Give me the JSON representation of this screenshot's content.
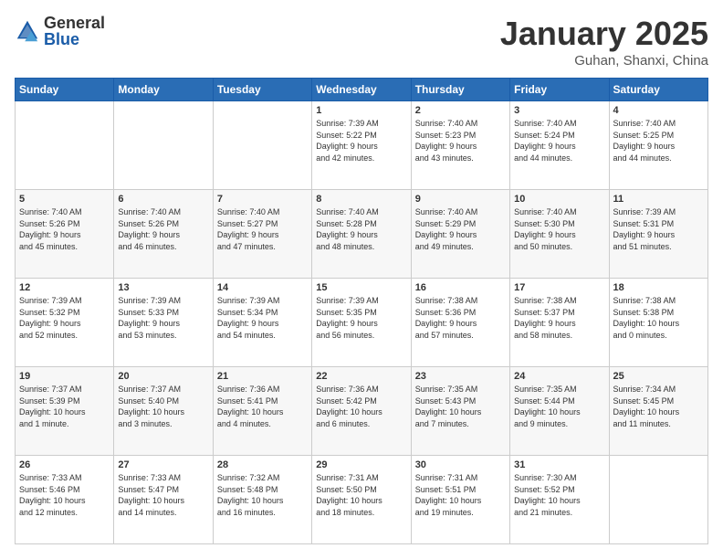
{
  "header": {
    "logo_general": "General",
    "logo_blue": "Blue",
    "title": "January 2025",
    "location": "Guhan, Shanxi, China"
  },
  "weekdays": [
    "Sunday",
    "Monday",
    "Tuesday",
    "Wednesday",
    "Thursday",
    "Friday",
    "Saturday"
  ],
  "weeks": [
    [
      {
        "day": "",
        "info": ""
      },
      {
        "day": "",
        "info": ""
      },
      {
        "day": "",
        "info": ""
      },
      {
        "day": "1",
        "info": "Sunrise: 7:39 AM\nSunset: 5:22 PM\nDaylight: 9 hours\nand 42 minutes."
      },
      {
        "day": "2",
        "info": "Sunrise: 7:40 AM\nSunset: 5:23 PM\nDaylight: 9 hours\nand 43 minutes."
      },
      {
        "day": "3",
        "info": "Sunrise: 7:40 AM\nSunset: 5:24 PM\nDaylight: 9 hours\nand 44 minutes."
      },
      {
        "day": "4",
        "info": "Sunrise: 7:40 AM\nSunset: 5:25 PM\nDaylight: 9 hours\nand 44 minutes."
      }
    ],
    [
      {
        "day": "5",
        "info": "Sunrise: 7:40 AM\nSunset: 5:26 PM\nDaylight: 9 hours\nand 45 minutes."
      },
      {
        "day": "6",
        "info": "Sunrise: 7:40 AM\nSunset: 5:26 PM\nDaylight: 9 hours\nand 46 minutes."
      },
      {
        "day": "7",
        "info": "Sunrise: 7:40 AM\nSunset: 5:27 PM\nDaylight: 9 hours\nand 47 minutes."
      },
      {
        "day": "8",
        "info": "Sunrise: 7:40 AM\nSunset: 5:28 PM\nDaylight: 9 hours\nand 48 minutes."
      },
      {
        "day": "9",
        "info": "Sunrise: 7:40 AM\nSunset: 5:29 PM\nDaylight: 9 hours\nand 49 minutes."
      },
      {
        "day": "10",
        "info": "Sunrise: 7:40 AM\nSunset: 5:30 PM\nDaylight: 9 hours\nand 50 minutes."
      },
      {
        "day": "11",
        "info": "Sunrise: 7:39 AM\nSunset: 5:31 PM\nDaylight: 9 hours\nand 51 minutes."
      }
    ],
    [
      {
        "day": "12",
        "info": "Sunrise: 7:39 AM\nSunset: 5:32 PM\nDaylight: 9 hours\nand 52 minutes."
      },
      {
        "day": "13",
        "info": "Sunrise: 7:39 AM\nSunset: 5:33 PM\nDaylight: 9 hours\nand 53 minutes."
      },
      {
        "day": "14",
        "info": "Sunrise: 7:39 AM\nSunset: 5:34 PM\nDaylight: 9 hours\nand 54 minutes."
      },
      {
        "day": "15",
        "info": "Sunrise: 7:39 AM\nSunset: 5:35 PM\nDaylight: 9 hours\nand 56 minutes."
      },
      {
        "day": "16",
        "info": "Sunrise: 7:38 AM\nSunset: 5:36 PM\nDaylight: 9 hours\nand 57 minutes."
      },
      {
        "day": "17",
        "info": "Sunrise: 7:38 AM\nSunset: 5:37 PM\nDaylight: 9 hours\nand 58 minutes."
      },
      {
        "day": "18",
        "info": "Sunrise: 7:38 AM\nSunset: 5:38 PM\nDaylight: 10 hours\nand 0 minutes."
      }
    ],
    [
      {
        "day": "19",
        "info": "Sunrise: 7:37 AM\nSunset: 5:39 PM\nDaylight: 10 hours\nand 1 minute."
      },
      {
        "day": "20",
        "info": "Sunrise: 7:37 AM\nSunset: 5:40 PM\nDaylight: 10 hours\nand 3 minutes."
      },
      {
        "day": "21",
        "info": "Sunrise: 7:36 AM\nSunset: 5:41 PM\nDaylight: 10 hours\nand 4 minutes."
      },
      {
        "day": "22",
        "info": "Sunrise: 7:36 AM\nSunset: 5:42 PM\nDaylight: 10 hours\nand 6 minutes."
      },
      {
        "day": "23",
        "info": "Sunrise: 7:35 AM\nSunset: 5:43 PM\nDaylight: 10 hours\nand 7 minutes."
      },
      {
        "day": "24",
        "info": "Sunrise: 7:35 AM\nSunset: 5:44 PM\nDaylight: 10 hours\nand 9 minutes."
      },
      {
        "day": "25",
        "info": "Sunrise: 7:34 AM\nSunset: 5:45 PM\nDaylight: 10 hours\nand 11 minutes."
      }
    ],
    [
      {
        "day": "26",
        "info": "Sunrise: 7:33 AM\nSunset: 5:46 PM\nDaylight: 10 hours\nand 12 minutes."
      },
      {
        "day": "27",
        "info": "Sunrise: 7:33 AM\nSunset: 5:47 PM\nDaylight: 10 hours\nand 14 minutes."
      },
      {
        "day": "28",
        "info": "Sunrise: 7:32 AM\nSunset: 5:48 PM\nDaylight: 10 hours\nand 16 minutes."
      },
      {
        "day": "29",
        "info": "Sunrise: 7:31 AM\nSunset: 5:50 PM\nDaylight: 10 hours\nand 18 minutes."
      },
      {
        "day": "30",
        "info": "Sunrise: 7:31 AM\nSunset: 5:51 PM\nDaylight: 10 hours\nand 19 minutes."
      },
      {
        "day": "31",
        "info": "Sunrise: 7:30 AM\nSunset: 5:52 PM\nDaylight: 10 hours\nand 21 minutes."
      },
      {
        "day": "",
        "info": ""
      }
    ]
  ]
}
